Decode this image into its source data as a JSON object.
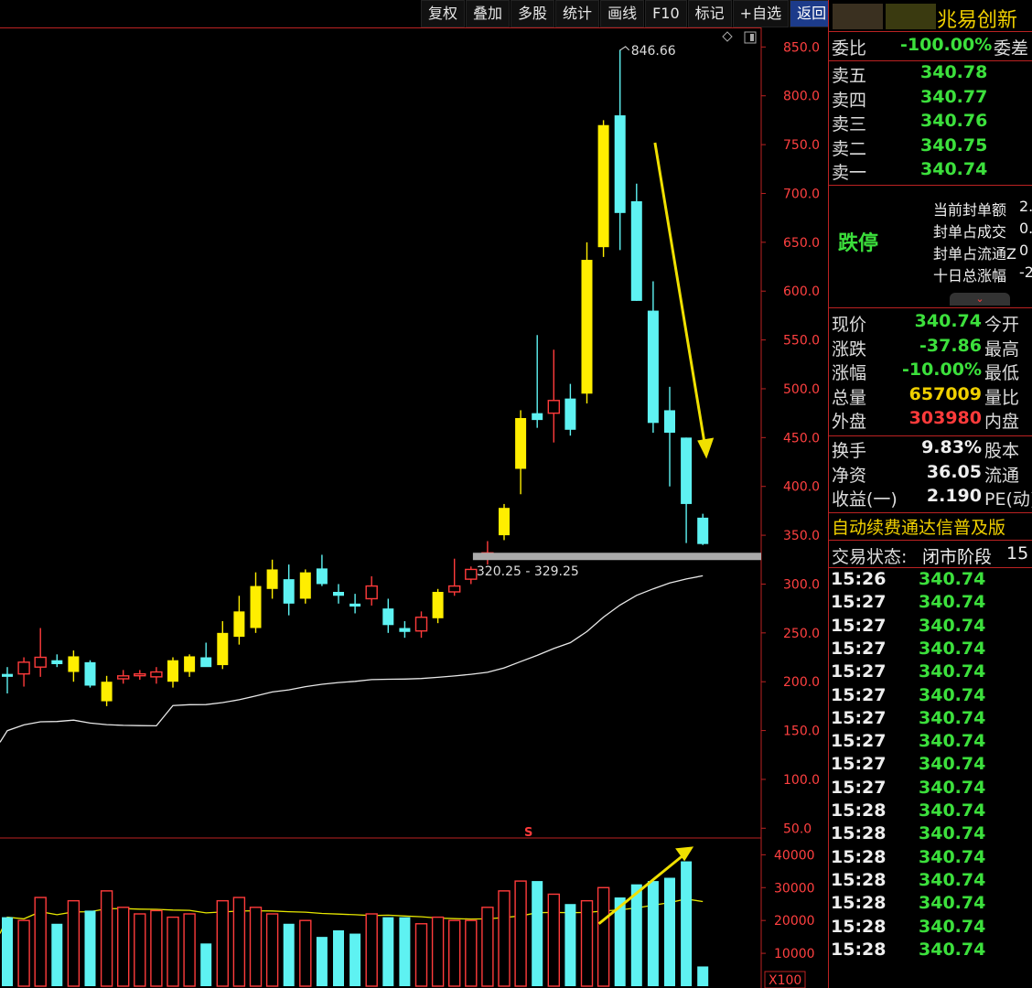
{
  "toolbar": [
    "复权",
    "叠加",
    "多股",
    "统计",
    "画线",
    "F10",
    "标记",
    "+自选",
    "返回"
  ],
  "stock_name": "兆易创新",
  "order_ratio": {
    "label": "委比",
    "value": "-100.00%",
    "label2": "委差"
  },
  "asks": [
    {
      "label": "卖五",
      "price": "340.78"
    },
    {
      "label": "卖四",
      "price": "340.77"
    },
    {
      "label": "卖三",
      "price": "340.76"
    },
    {
      "label": "卖二",
      "price": "340.75"
    },
    {
      "label": "卖一",
      "price": "340.74"
    }
  ],
  "limit_panel": {
    "status": "跌停",
    "rows": [
      {
        "label": "当前封单额",
        "value": "2."
      },
      {
        "label": "封单占成交",
        "value": "0."
      },
      {
        "label": "封单占流通Z",
        "value": "0"
      },
      {
        "label": "十日总涨幅",
        "value": "-2"
      }
    ]
  },
  "quote": [
    {
      "label": "现价",
      "value": "340.74",
      "label2": "今开",
      "color": "green"
    },
    {
      "label": "涨跌",
      "value": "-37.86",
      "label2": "最高",
      "color": "green"
    },
    {
      "label": "涨幅",
      "value": "-10.00%",
      "label2": "最低",
      "color": "green"
    },
    {
      "label": "总量",
      "value": "657009",
      "label2": "量比",
      "color": "gold"
    },
    {
      "label": "外盘",
      "value": "303980",
      "label2": "内盘",
      "color": "red"
    }
  ],
  "quote2": [
    {
      "label": "换手",
      "value": "9.83%",
      "label2": "股本"
    },
    {
      "label": "净资",
      "value": "36.05",
      "label2": "流通"
    },
    {
      "label": "收益(一)",
      "value": "2.190",
      "label2": "PE(动)"
    }
  ],
  "banner": "自动续费通达信普及版",
  "trade_status": {
    "label": "交易状态:",
    "value": "闭市阶段",
    "extra": "15"
  },
  "ticks": [
    {
      "time": "15:26",
      "price": "340.74"
    },
    {
      "time": "15:27",
      "price": "340.74"
    },
    {
      "time": "15:27",
      "price": "340.74"
    },
    {
      "time": "15:27",
      "price": "340.74"
    },
    {
      "time": "15:27",
      "price": "340.74"
    },
    {
      "time": "15:27",
      "price": "340.74"
    },
    {
      "time": "15:27",
      "price": "340.74"
    },
    {
      "time": "15:27",
      "price": "340.74"
    },
    {
      "time": "15:27",
      "price": "340.74"
    },
    {
      "time": "15:27",
      "price": "340.74"
    },
    {
      "time": "15:28",
      "price": "340.74"
    },
    {
      "time": "15:28",
      "price": "340.74"
    },
    {
      "time": "15:28",
      "price": "340.74"
    },
    {
      "time": "15:28",
      "price": "340.74"
    },
    {
      "time": "15:28",
      "price": "340.74"
    },
    {
      "time": "15:28",
      "price": "340.74"
    },
    {
      "time": "15:28",
      "price": "340.74"
    }
  ],
  "chart_data": {
    "type": "candlestick",
    "price_axis": {
      "ticks": [
        50,
        100,
        150,
        200,
        250,
        300,
        350,
        400,
        450,
        500,
        550,
        600,
        650,
        700,
        750,
        800,
        850
      ],
      "range": [
        40,
        870
      ]
    },
    "volume_axis": {
      "ticks": [
        10000,
        20000,
        30000,
        40000
      ],
      "unit": "X100",
      "range": [
        0,
        44000
      ]
    },
    "annotations": {
      "high": "846.66",
      "support": "320.25 - 329.25",
      "marker": "S"
    },
    "candles": [
      {
        "o": 208,
        "h": 215,
        "l": 188,
        "c": 205,
        "v": 21000
      },
      {
        "o": 208,
        "h": 225,
        "l": 195,
        "c": 220,
        "v": 20000
      },
      {
        "o": 215,
        "h": 255,
        "l": 205,
        "c": 225,
        "v": 27000
      },
      {
        "o": 222,
        "h": 228,
        "l": 215,
        "c": 218,
        "v": 19000
      },
      {
        "o": 210,
        "h": 232,
        "l": 200,
        "c": 226,
        "v": 26000
      },
      {
        "o": 220,
        "h": 222,
        "l": 194,
        "c": 196,
        "v": 23000
      },
      {
        "o": 180,
        "h": 206,
        "l": 175,
        "c": 200,
        "v": 29000
      },
      {
        "o": 203,
        "h": 212,
        "l": 198,
        "c": 206,
        "v": 24000
      },
      {
        "o": 207,
        "h": 212,
        "l": 202,
        "c": 208,
        "v": 22000
      },
      {
        "o": 205,
        "h": 215,
        "l": 198,
        "c": 210,
        "v": 23000
      },
      {
        "o": 200,
        "h": 225,
        "l": 194,
        "c": 222,
        "v": 21000
      },
      {
        "o": 210,
        "h": 228,
        "l": 205,
        "c": 226,
        "v": 22000
      },
      {
        "o": 225,
        "h": 240,
        "l": 220,
        "c": 215,
        "v": 13000
      },
      {
        "o": 217,
        "h": 262,
        "l": 213,
        "c": 250,
        "v": 26000
      },
      {
        "o": 246,
        "h": 288,
        "l": 238,
        "c": 272,
        "v": 27000
      },
      {
        "o": 255,
        "h": 312,
        "l": 250,
        "c": 298,
        "v": 24000
      },
      {
        "o": 295,
        "h": 325,
        "l": 285,
        "c": 315,
        "v": 22000
      },
      {
        "o": 305,
        "h": 320,
        "l": 268,
        "c": 280,
        "v": 19000
      },
      {
        "o": 285,
        "h": 315,
        "l": 280,
        "c": 312,
        "v": 20000
      },
      {
        "o": 316,
        "h": 330,
        "l": 298,
        "c": 300,
        "v": 15000
      },
      {
        "o": 292,
        "h": 300,
        "l": 280,
        "c": 288,
        "v": 17000
      },
      {
        "o": 280,
        "h": 290,
        "l": 270,
        "c": 277,
        "v": 16000
      },
      {
        "o": 285,
        "h": 308,
        "l": 278,
        "c": 298,
        "v": 22000
      },
      {
        "o": 275,
        "h": 285,
        "l": 250,
        "c": 258,
        "v": 21000
      },
      {
        "o": 255,
        "h": 262,
        "l": 245,
        "c": 251,
        "v": 21000
      },
      {
        "o": 252,
        "h": 272,
        "l": 245,
        "c": 266,
        "v": 19000
      },
      {
        "o": 265,
        "h": 295,
        "l": 260,
        "c": 292,
        "v": 21000
      },
      {
        "o": 292,
        "h": 326,
        "l": 288,
        "c": 298,
        "v": 20000
      },
      {
        "o": 305,
        "h": 318,
        "l": 300,
        "c": 315,
        "v": 20000
      },
      {
        "o": 326,
        "h": 344,
        "l": 320,
        "c": 332,
        "v": 24000
      },
      {
        "o": 350,
        "h": 382,
        "l": 345,
        "c": 378,
        "v": 29000
      },
      {
        "o": 418,
        "h": 478,
        "l": 392,
        "c": 470,
        "v": 32000
      },
      {
        "o": 475,
        "h": 555,
        "l": 460,
        "c": 468,
        "v": 32000
      },
      {
        "o": 475,
        "h": 540,
        "l": 445,
        "c": 488,
        "v": 28000
      },
      {
        "o": 490,
        "h": 505,
        "l": 452,
        "c": 458,
        "v": 25000
      },
      {
        "o": 495,
        "h": 650,
        "l": 485,
        "c": 632,
        "v": 26000
      },
      {
        "o": 645,
        "h": 775,
        "l": 635,
        "c": 770,
        "v": 30000
      },
      {
        "o": 780,
        "h": 847,
        "l": 642,
        "c": 680,
        "v": 27000
      },
      {
        "o": 692,
        "h": 710,
        "l": 590,
        "c": 590,
        "v": 31000
      },
      {
        "o": 580,
        "h": 610,
        "l": 455,
        "c": 465,
        "v": 32000
      },
      {
        "o": 478,
        "h": 502,
        "l": 400,
        "c": 455,
        "v": 33000
      },
      {
        "o": 450,
        "h": 450,
        "l": 342,
        "c": 382,
        "v": 38000
      },
      {
        "o": 368,
        "h": 372,
        "l": 340,
        "c": 341,
        "v": 6000
      }
    ]
  }
}
